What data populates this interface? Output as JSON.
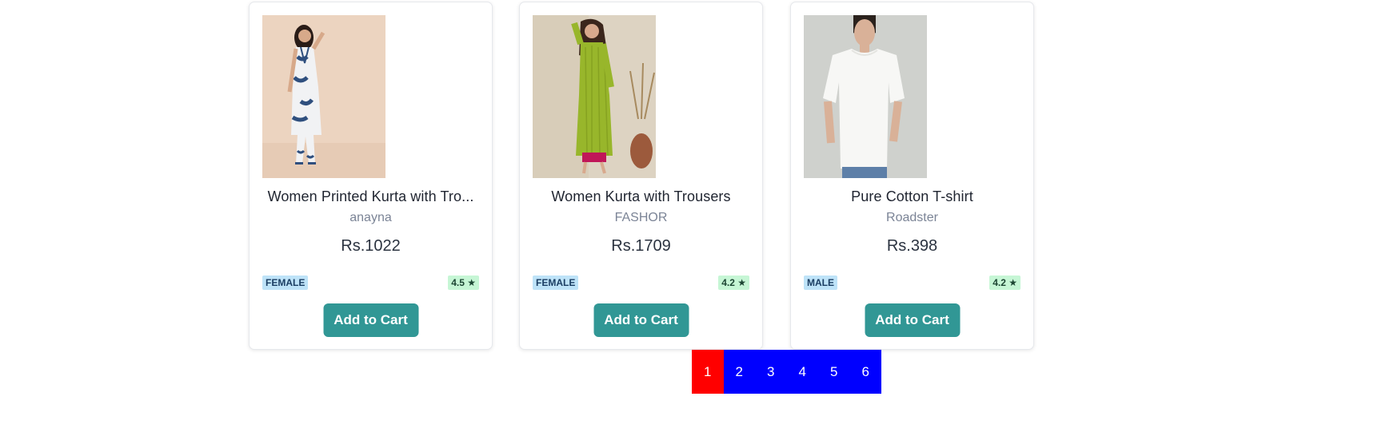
{
  "products": [
    {
      "name": "Women Printed Kurta with Tro...",
      "brand": "anayna",
      "price": "Rs.1022",
      "gender": "FEMALE",
      "rating": "4.5 ★",
      "cta": "Add to Cart"
    },
    {
      "name": "Women Kurta with Trousers",
      "brand": "FASHOR",
      "price": "Rs.1709",
      "gender": "FEMALE",
      "rating": "4.2 ★",
      "cta": "Add to Cart"
    },
    {
      "name": "Pure Cotton T-shirt",
      "brand": "Roadster",
      "price": "Rs.398",
      "gender": "MALE",
      "rating": "4.2 ★",
      "cta": "Add to Cart"
    }
  ],
  "pagination": {
    "pages": [
      "1",
      "2",
      "3",
      "4",
      "5",
      "6"
    ],
    "current": "1",
    "active_color": "#ff0000",
    "inactive_color": "#0000ff"
  },
  "colors": {
    "cta": "#319795",
    "gender_badge_bg": "#bee3f8",
    "rating_badge_bg": "#c6f6d5"
  },
  "icons": {
    "rating": "star-icon"
  }
}
